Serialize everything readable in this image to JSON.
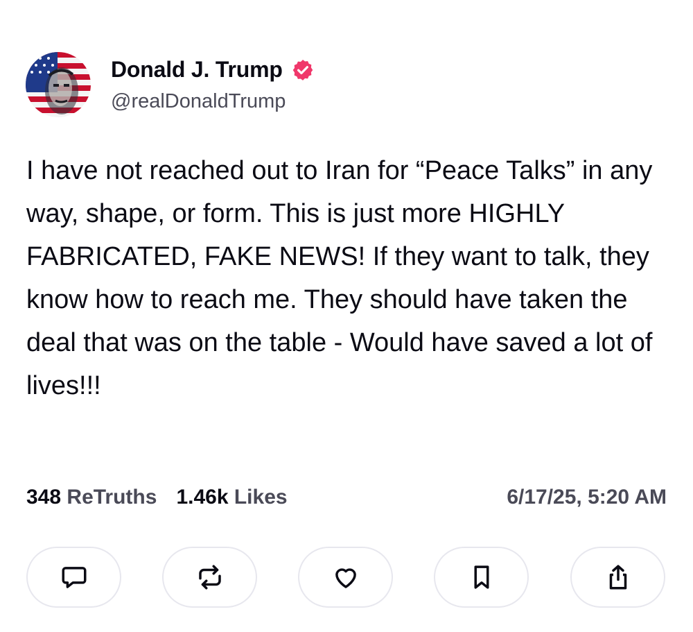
{
  "author": {
    "display_name": "Donald J. Trump",
    "handle": "@realDonaldTrump",
    "verified": true,
    "verified_color": "#f0386b",
    "avatar_icon": "flag-portrait-avatar"
  },
  "post": {
    "text": "I have not reached out to Iran for “Peace Talks” in any way, shape, or form. This is just more HIGHLY FABRICATED, FAKE NEWS! If they want to talk, they know how to reach me. They should have taken the deal that was on the table - Would have saved a lot of lives!!!",
    "retruths_count": "348",
    "retruths_label": "ReTruths",
    "likes_count": "1.46k",
    "likes_label": "Likes",
    "timestamp": "6/17/25, 5:20 AM"
  },
  "actions": [
    {
      "name": "reply",
      "icon": "comment-icon"
    },
    {
      "name": "retruth",
      "icon": "repost-icon"
    },
    {
      "name": "like",
      "icon": "heart-icon"
    },
    {
      "name": "bookmark",
      "icon": "bookmark-icon"
    },
    {
      "name": "share",
      "icon": "share-icon"
    }
  ],
  "colors": {
    "text": "#0b0b14",
    "muted": "#4a4a57",
    "button_border": "#e7e7ee"
  }
}
